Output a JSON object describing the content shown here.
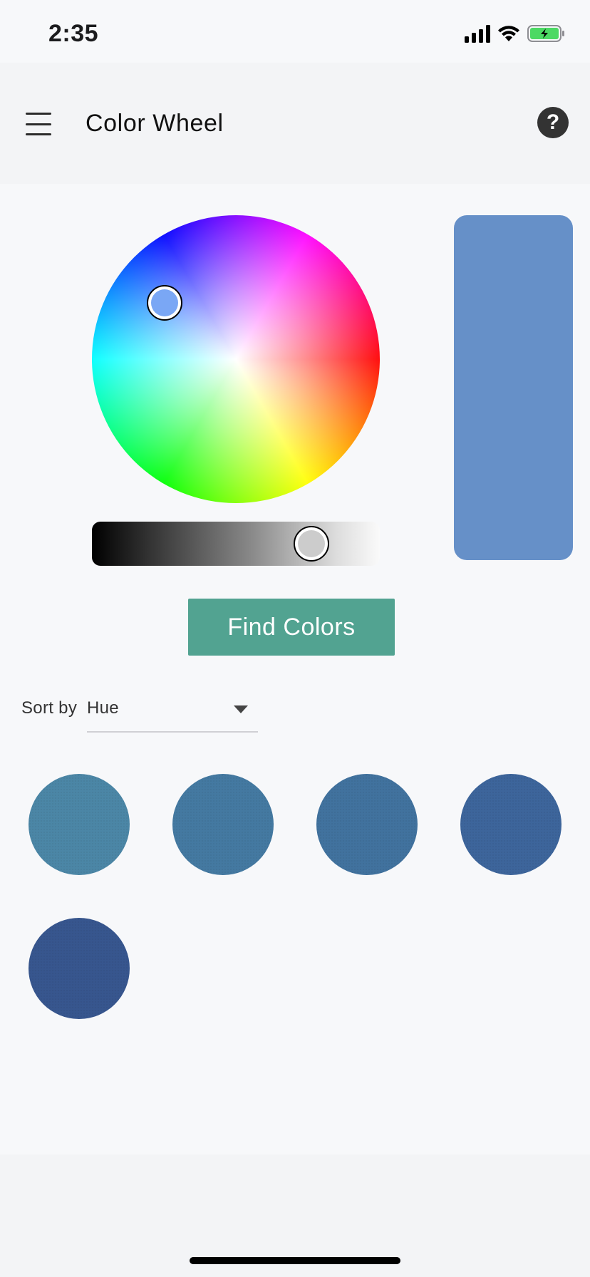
{
  "status_bar": {
    "time": "2:35",
    "icons": [
      "cellular-signal-icon",
      "wifi-icon",
      "battery-charging-icon"
    ],
    "battery_color": "#4cd964"
  },
  "header": {
    "title": "Color Wheel",
    "menu_icon": "hamburger-menu-icon",
    "help_label": "?"
  },
  "picker": {
    "handle_color": "#7aa7f5",
    "brightness_level": 0.8,
    "brightness_thumb_color": "#cccccc",
    "preview_color": "#6690c8"
  },
  "actions": {
    "find_colors_label": "Find Colors",
    "find_colors_bg": "#52a391"
  },
  "sort": {
    "label": "Sort by",
    "selected": "Hue"
  },
  "swatches": [
    {
      "color": "#4b86a6"
    },
    {
      "color": "#4479a1"
    },
    {
      "color": "#41729e"
    },
    {
      "color": "#3d659b"
    },
    {
      "color": "#37568e"
    }
  ]
}
